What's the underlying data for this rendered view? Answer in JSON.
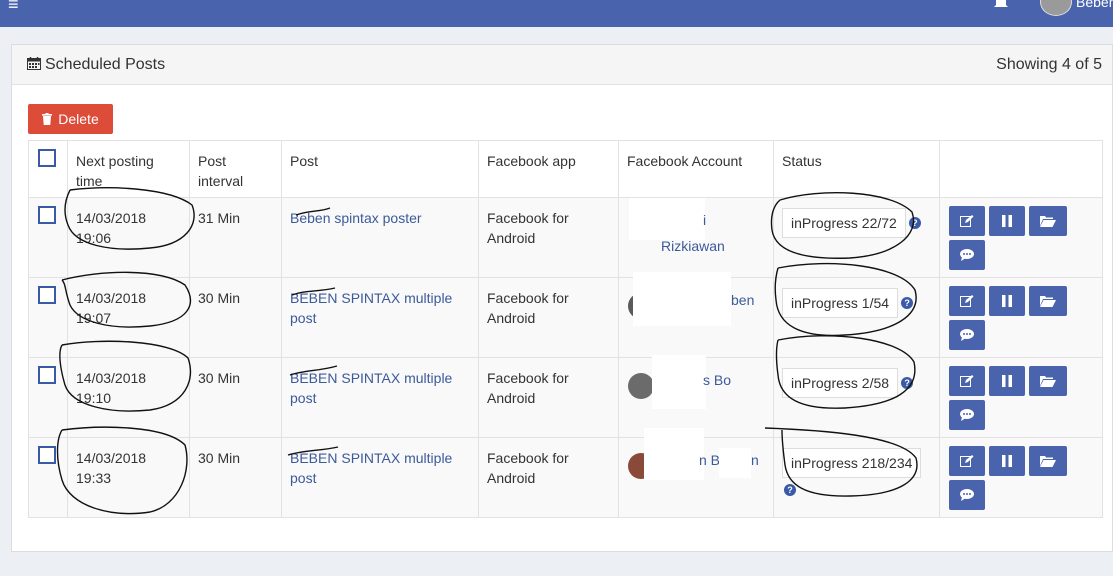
{
  "topbar": {
    "user_name": "Beben",
    "hamburger": "≡"
  },
  "panel": {
    "title": "Scheduled Posts",
    "showing": "Showing 4 of 5"
  },
  "toolbar": {
    "delete_label": "Delete"
  },
  "table": {
    "headers": {
      "next_posting_time": "Next posting time",
      "post_interval": "Post interval",
      "post": "Post",
      "facebook_app": "Facebook app",
      "facebook_account": "Facebook Account",
      "status": "Status"
    },
    "rows": [
      {
        "time": "14/03/2018 19:06",
        "interval": "31 Min",
        "post": "Beben spintax poster",
        "app": "Facebook for Android",
        "account_a": "i",
        "account_b": "Rizkiawan",
        "status": "inProgress 22/72"
      },
      {
        "time": "14/03/2018 19:07",
        "interval": "30 Min",
        "post": "BEBEN SPINTAX multiple post",
        "app": "Facebook for Android",
        "account_a": "ben",
        "account_b": "",
        "status": "inProgress 1/54"
      },
      {
        "time": "14/03/2018 19:10",
        "interval": "30 Min",
        "post": "BEBEN SPINTAX multiple post",
        "app": "Facebook for Android",
        "account_a": "s Bo",
        "account_b": "",
        "status": "inProgress 2/58"
      },
      {
        "time": "14/03/2018 19:33",
        "interval": "30 Min",
        "post": "BEBEN SPINTAX multiple post",
        "app": "Facebook for Android",
        "account_a": "n B",
        "account_b": "n",
        "status": "inProgress 218/234"
      }
    ]
  },
  "icons": {
    "help": "?"
  },
  "colors": {
    "topbar": "#4a63ad",
    "delete": "#dd4b39",
    "action": "#4a63ad",
    "link": "#3c5a9a"
  }
}
